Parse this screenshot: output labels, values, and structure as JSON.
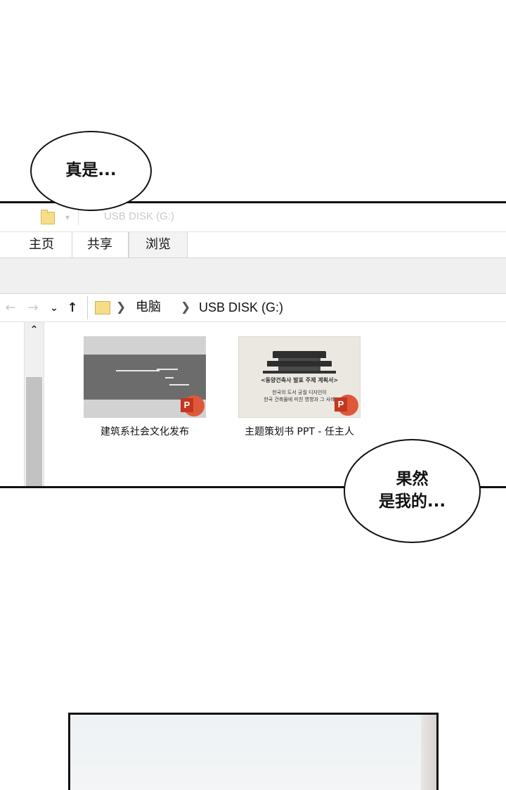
{
  "bubbles": {
    "top": "真是...",
    "bottom_line1": "果然",
    "bottom_line2": "是我的..."
  },
  "window": {
    "title": "USB DISK (G:)"
  },
  "ribbon": {
    "tabs": [
      {
        "label": "主页"
      },
      {
        "label": "共享"
      },
      {
        "label": "浏览",
        "active": true
      }
    ]
  },
  "address": {
    "crumbs": [
      "电脑",
      "USB DISK (G:)"
    ],
    "chevron": "❯"
  },
  "icons": {
    "back": "←",
    "forward": "→",
    "recent": "⌄",
    "up": "↑",
    "scroll_up": "⌃",
    "ppt_letter": "P"
  },
  "files": [
    {
      "name": "建筑系社会文化发布",
      "thumbnail_lines": []
    },
    {
      "name": "主题策划书 PPT - 任主人",
      "thumbnail_lines": [
        "<동양건축사 발표 주제 계획서>",
        "한국의 도서 궁궐 디자인이",
        "한국 건축물에 미친 영향과 그 사례"
      ]
    }
  ],
  "colors": {
    "folder": "#f6dd87",
    "ppt_red": "#c3371e",
    "ppt_orange": "#e0583a"
  }
}
